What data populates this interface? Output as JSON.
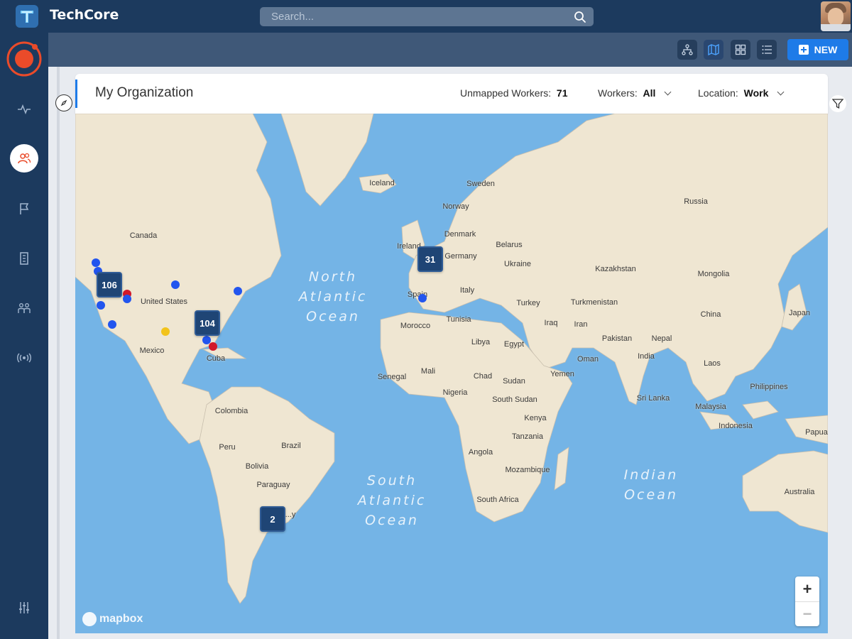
{
  "app": {
    "name": "TechCore"
  },
  "search": {
    "placeholder": "Search..."
  },
  "toolbar": {
    "new_label": "NEW"
  },
  "header": {
    "title": "My Organization",
    "unmapped_label": "Unmapped Workers:",
    "unmapped_count": "71",
    "workers_label": "Workers:",
    "workers_value": "All",
    "location_label": "Location:",
    "location_value": "Work"
  },
  "map": {
    "oceans": {
      "north_atlantic": [
        "North",
        "Atlantic",
        "Ocean"
      ],
      "south_atlantic": [
        "South",
        "Atlantic",
        "Ocean"
      ],
      "indian": [
        "Indian",
        "Ocean"
      ]
    },
    "countries": {
      "iceland": "Iceland",
      "sweden": "Sweden",
      "norway": "Norway",
      "russia": "Russia",
      "denmark": "Denmark",
      "ireland": "Ireland",
      "belarus": "Belarus",
      "germany": "Germany",
      "ukraine": "Ukraine",
      "kazakhstan": "Kazakhstan",
      "mongolia": "Mongolia",
      "canada": "Canada",
      "united_states": "United States",
      "italy": "Italy",
      "spain": "Spain",
      "turkey": "Turkey",
      "turkmenistan": "Turkmenistan",
      "china": "China",
      "japan": "Japan",
      "morocco": "Morocco",
      "tunisia": "Tunisia",
      "iraq": "Iraq",
      "iran": "Iran",
      "libya": "Libya",
      "egypt": "Egypt",
      "pakistan": "Pakistan",
      "nepal": "Nepal",
      "mexico": "Mexico",
      "cuba": "Cuba",
      "oman": "Oman",
      "india": "India",
      "mali": "Mali",
      "senegal": "Senegal",
      "chad": "Chad",
      "sudan": "Sudan",
      "yemen": "Yemen",
      "laos": "Laos",
      "nigeria": "Nigeria",
      "south_sudan": "South Sudan",
      "philippines": "Philippines",
      "sri_lanka": "Sri Lanka",
      "colombia": "Colombia",
      "kenya": "Kenya",
      "malaysia": "Malaysia",
      "indonesia": "Indonesia",
      "tanzania": "Tanzania",
      "peru": "Peru",
      "brazil": "Brazil",
      "papua": "Papua",
      "angola": "Angola",
      "bolivia": "Bolivia",
      "mozambique": "Mozambique",
      "paraguay": "Paraguay",
      "australia": "Australia",
      "south_africa": "South Africa",
      "uruguay": "...y"
    },
    "clusters": {
      "west_us": "106",
      "east_us": "104",
      "europe": "31",
      "south_america": "2"
    },
    "dot_colors": {
      "blue": "#2255ee",
      "red": "#d1182b",
      "yellow": "#f2c31b"
    },
    "attribution": "mapbox",
    "zoom_in": "+",
    "zoom_out": "−"
  }
}
